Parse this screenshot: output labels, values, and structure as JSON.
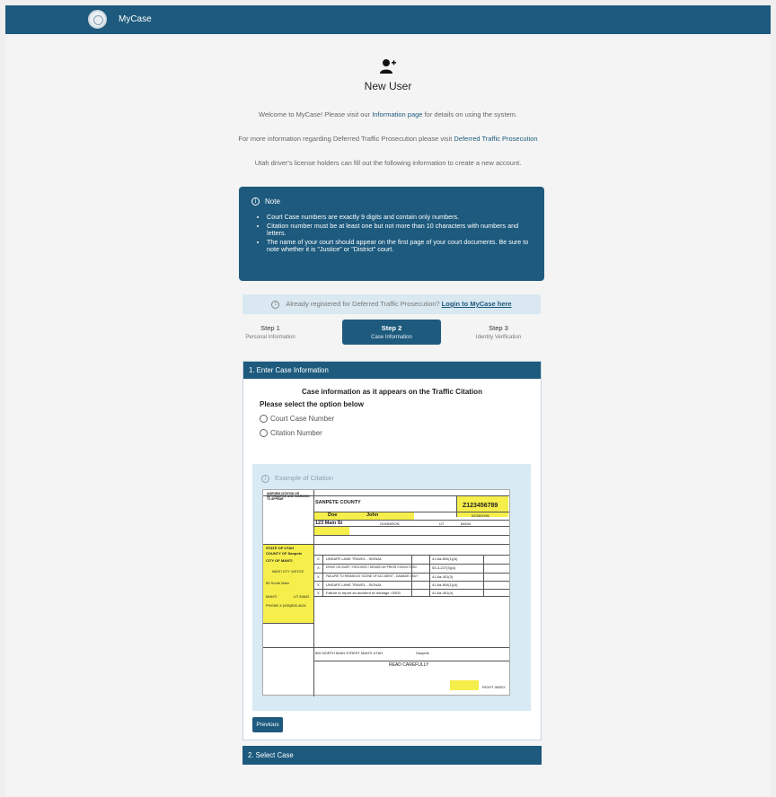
{
  "header": {
    "brand": "MyCase"
  },
  "icons": {
    "seal": "state-seal-icon",
    "new_user": "add-user-icon",
    "info": "info-circle-icon"
  },
  "colors": {
    "primary": "#1d5a7d",
    "light_panel": "#d9e8f1",
    "highlight": "#f5ee4b"
  },
  "page": {
    "title": "New User",
    "welcome_pre": "Welcome to MyCase! Please visit our ",
    "welcome_link": "Information page",
    "welcome_post": " for details on using the system.",
    "dtp_pre": "For more information regarding Deferred Traffic Prosecution please visit ",
    "dtp_link": "Deferred Traffic Prosecution",
    "utah_note": "Utah driver's license holders can fill out the following information to create a new account."
  },
  "note": {
    "heading": "Note",
    "items": [
      "Court Case numbers are exactly 9 digits and contain only numbers.",
      "Citation number must be at least one but not more than 10 characters with numbers and letters.",
      "The name of your court should appear on the first page of your court documents. Be sure to note whether it is \"Justice\" or \"District\" court."
    ]
  },
  "already": {
    "text": "Already registered for Deferred Traffic Prosecution? ",
    "link": "Login to MyCase here"
  },
  "steps": [
    {
      "number": "Step 1",
      "label": "Personal Information"
    },
    {
      "number": "Step 2",
      "label": "Case Information"
    },
    {
      "number": "Step 3",
      "label": "Identity Verification"
    }
  ],
  "section1": {
    "heading": "1. Enter Case Information",
    "case_title": "Case information as it appears on the Traffic Citation",
    "select_label": "Please select the option below",
    "options": [
      "Court Case Number",
      "Citation Number"
    ],
    "example_heading": "Example of Citation",
    "previous": "Previous"
  },
  "citation": {
    "header": "UNIFORM CITATION OR INFORMATION AND SUMMONS TO APPEAR",
    "agency": "SANPETE COUNTY",
    "citation_no": "Z123456789",
    "last_name": "Doe",
    "first_name": "John",
    "street": "123 Main St",
    "city": "GUNNISON",
    "state": "UT",
    "zip": "84634",
    "dob": "02/28/1991",
    "court_state": "STATE OF UTAH",
    "court_county": "COUNTY OF Sanpete",
    "court_city": "CITY OF MANTI",
    "court_name": "MANTI CITY JUSTICE",
    "court_street": "50 South Main",
    "court_town": "MANTI",
    "court_stzip": "UT 84642",
    "phone": "PHONE # (435)835-4631",
    "violations": [
      {
        "desc": "UNSAFE LANE TRAVEL - SIGNAL",
        "code": "41-6a-804(1)(A)"
      },
      {
        "desc": "DRIVE ON SUSP / REVOKED / DENIED W/ PRIOR CONVICTION",
        "code": "53-3-227(3)(A)"
      },
      {
        "desc": "FAILURE TO REMAIN AT SCENE OF ACCIDENT - DAMAGE ONLY",
        "code": "41-6a-401(3)"
      },
      {
        "desc": "UNSAFE LANE TRAVEL - SIGNAL",
        "code": "41-6a-804(1)(A)"
      },
      {
        "desc": "Failure to report an accident w/ damage >2500",
        "code": "41-6a-401(4)"
      }
    ],
    "location": "800 NORTH MAIN STREET MANTI UTAH",
    "county": "Sanpete",
    "read": "READ CAREFULLY",
    "right_index": "RIGHT INDEX"
  },
  "section2": {
    "heading": "2. Select Case"
  }
}
